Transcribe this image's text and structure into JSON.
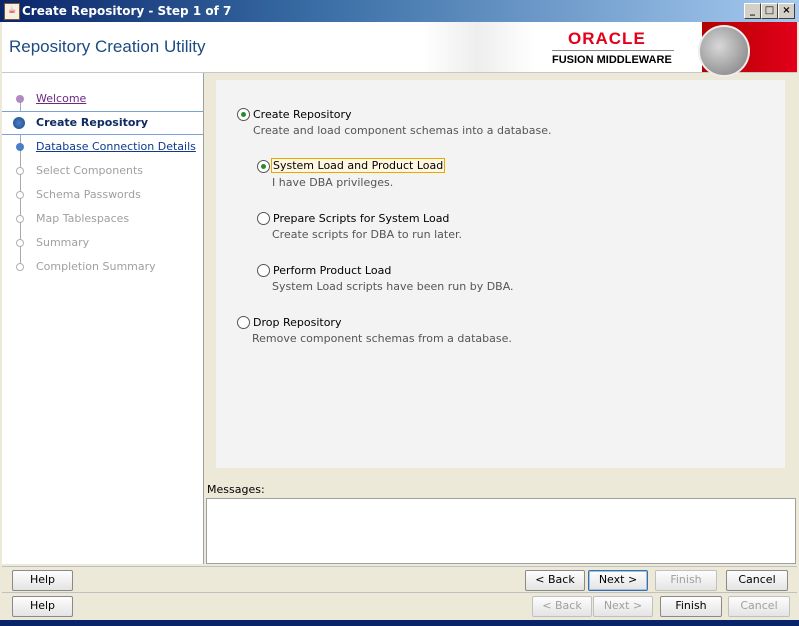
{
  "window": {
    "title": "Create Repository - Step 1 of 7"
  },
  "header": {
    "title": "Repository Creation Utility",
    "brand": "ORACLE",
    "brand_sub": "FUSION MIDDLEWARE"
  },
  "nav": {
    "items": [
      {
        "label": "Welcome",
        "state": "visited"
      },
      {
        "label": "Create Repository",
        "state": "current"
      },
      {
        "label": "Database Connection Details",
        "state": "link"
      },
      {
        "label": "Select Components",
        "state": "disabled"
      },
      {
        "label": "Schema Passwords",
        "state": "disabled"
      },
      {
        "label": "Map Tablespaces",
        "state": "disabled"
      },
      {
        "label": "Summary",
        "state": "disabled"
      },
      {
        "label": "Completion Summary",
        "state": "disabled"
      }
    ]
  },
  "options": {
    "create": {
      "label": "Create Repository",
      "desc": "Create and load component schemas into a database.",
      "checked": true
    },
    "system_product": {
      "label": "System Load and Product Load",
      "desc": "I have DBA privileges.",
      "checked": true
    },
    "prepare_scripts": {
      "label": "Prepare Scripts for System Load",
      "desc": "Create scripts for DBA to run later.",
      "checked": false
    },
    "product_load": {
      "label": "Perform Product Load",
      "desc": "System Load scripts have been run by DBA.",
      "checked": false
    },
    "drop": {
      "label": "Drop Repository",
      "desc": "Remove component schemas from a database.",
      "checked": false
    }
  },
  "messages": {
    "label": "Messages:"
  },
  "buttons_row1": {
    "help": "Help",
    "back": "< Back",
    "next": "Next >",
    "finish": "Finish",
    "cancel": "Cancel"
  },
  "buttons_row2": {
    "help": "Help",
    "back": "< Back",
    "next": "Next >",
    "finish": "Finish",
    "cancel": "Cancel"
  },
  "colors": {
    "accent": "#1c4b82",
    "oracle_red": "#e2001a",
    "selected_radio": "#2a8a2a"
  }
}
